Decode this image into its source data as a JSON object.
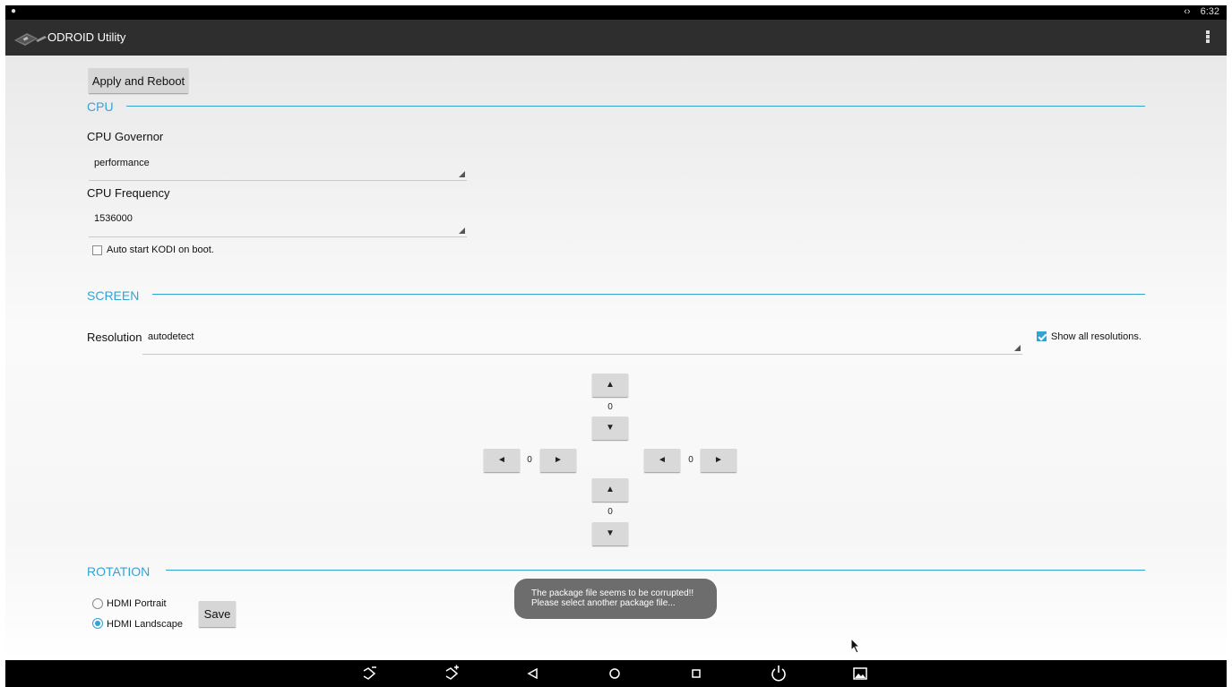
{
  "status_bar": {
    "time": "6:32",
    "sync_glyph": "‹›",
    "notification_icon": "android-icon"
  },
  "action_bar": {
    "title": "ODROID Utility",
    "logo_icon": "odroid-board-icon",
    "menu_icon": "overflow-menu-icon"
  },
  "apply_button": "Apply and Reboot",
  "cpu": {
    "section_title": "CPU",
    "governor_label": "CPU Governor",
    "governor_value": "performance",
    "frequency_label": "CPU Frequency",
    "frequency_value": "1536000",
    "kodi_checkbox_label": "Auto start KODI on boot.",
    "kodi_checked": false
  },
  "screen": {
    "section_title": "SCREEN",
    "resolution_label": "Resolution",
    "resolution_value": "autodetect",
    "show_all_label": "Show all resolutions.",
    "show_all_checked": true,
    "offsets": {
      "top": "0",
      "left": "0",
      "right": "0",
      "bottom": "0"
    },
    "arrow_glyphs": {
      "up": "▲",
      "down": "▼",
      "left": "◄",
      "right": "►"
    }
  },
  "rotation": {
    "section_title": "ROTATION",
    "options": [
      "HDMI Portrait",
      "HDMI Landscape"
    ],
    "selected": "HDMI Landscape",
    "save_button": "Save"
  },
  "toast": {
    "line1": "The package file seems to be corrupted!!",
    "line2": "Please select another package file..."
  },
  "nav_bar": {
    "icons": [
      "volume-down-icon",
      "volume-up-icon",
      "back-icon",
      "home-icon",
      "recents-icon",
      "power-icon",
      "screenshot-icon"
    ]
  },
  "colors": {
    "accent": "#33a3d4",
    "action_bar": "#2e2e2e",
    "toast": "#6d6d6d"
  }
}
